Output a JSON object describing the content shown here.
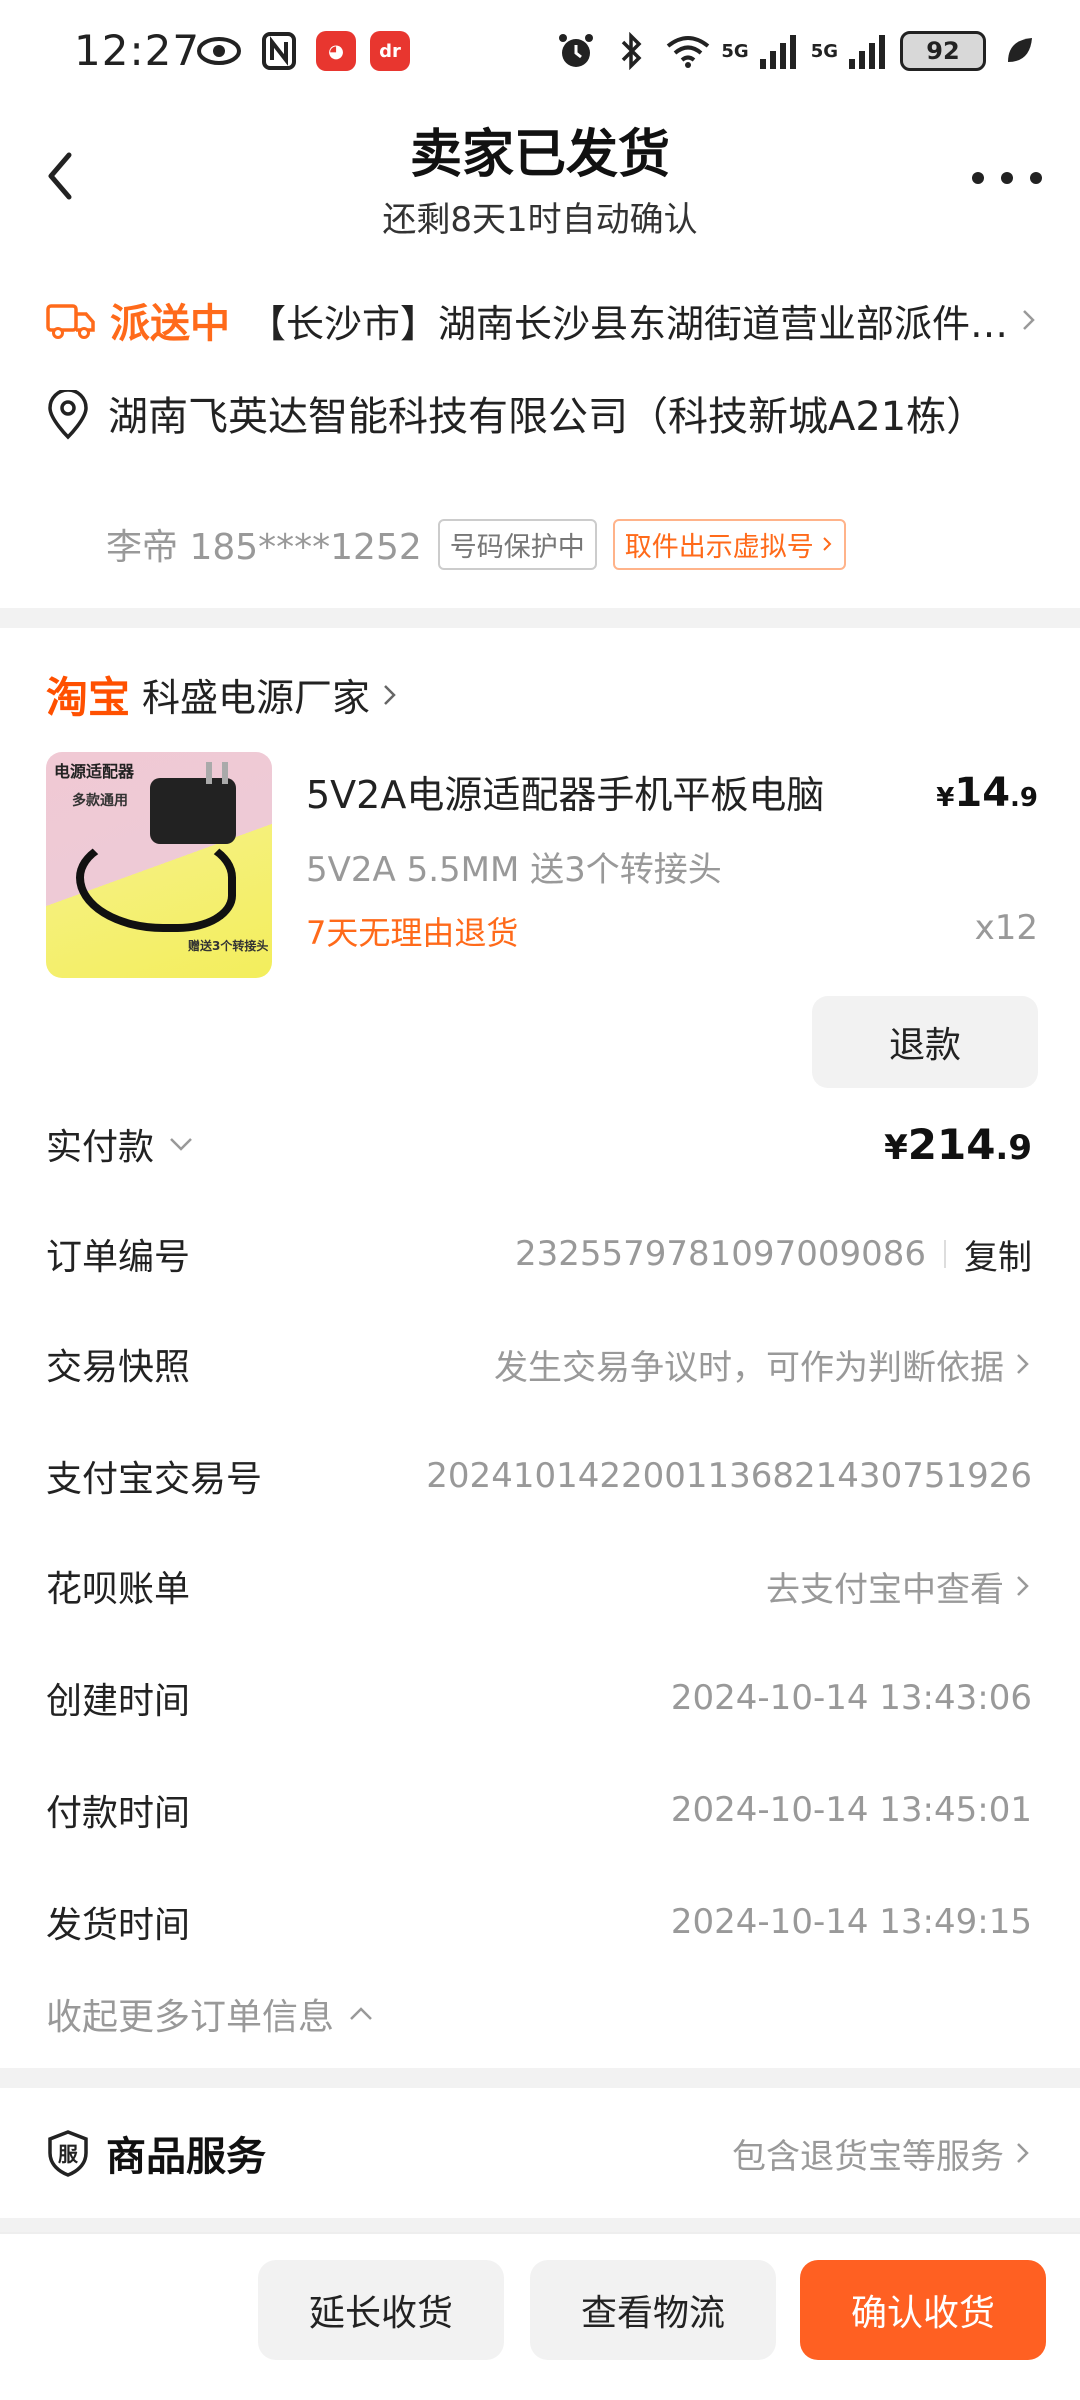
{
  "status_bar": {
    "time": "12:27",
    "battery": "92",
    "network_label_1": "5G",
    "network_label_2": "5G"
  },
  "header": {
    "title": "卖家已发货",
    "subtitle": "还剩8天1时自动确认"
  },
  "delivery": {
    "status": "派送中",
    "text": "【长沙市】湖南长沙县东湖街道营业部派件员正在为您派件"
  },
  "address": {
    "text": "湖南飞英达智能科技有限公司（科技新城A21栋）",
    "contact": "李帝 185****1252",
    "tag_protected": "号码保护中",
    "tag_virtual": "取件出示虚拟号"
  },
  "shop": {
    "platform": "淘宝",
    "name": "科盛电源厂家"
  },
  "product": {
    "image_text_1": "电源适配器",
    "image_text_2": "多款通用",
    "image_text_3": "赠送3个转接头",
    "title": "5V2A电源适配器手机平板电脑",
    "price_symbol": "¥",
    "price_int": "14",
    "price_dec": ".9",
    "spec": "5V2A 5.5MM 送3个转接头",
    "return_policy": "7天无理由退货",
    "quantity": "x12",
    "refund_label": "退款"
  },
  "order_info": {
    "paid_label": "实付款",
    "paid_symbol": "¥",
    "paid_int": "214",
    "paid_dec": ".9",
    "order_no_label": "订单编号",
    "order_no": "2325579781097009086",
    "copy_label": "复制",
    "snapshot_label": "交易快照",
    "snapshot_value": "发生交易争议时，可作为判断依据",
    "alipay_label": "支付宝交易号",
    "alipay_value": "2024101422001136821430751926",
    "huabei_label": "花呗账单",
    "huabei_value": "去支付宝中查看",
    "created_label": "创建时间",
    "created_value": "2024-10-14 13:43:06",
    "paid_time_label": "付款时间",
    "paid_time_value": "2024-10-14 13:45:01",
    "shipped_label": "发货时间",
    "shipped_value": "2024-10-14 13:49:15",
    "collapse_label": "收起更多订单信息"
  },
  "service": {
    "title": "商品服务",
    "desc": "包含退货宝等服务"
  },
  "bottom_bar": {
    "extend_label": "延长收货",
    "logistics_label": "查看物流",
    "confirm_label": "确认收货"
  },
  "colors": {
    "accent": "#ff6a1a",
    "confirm_button": "#ff6022",
    "taobao": "#ff5000"
  }
}
